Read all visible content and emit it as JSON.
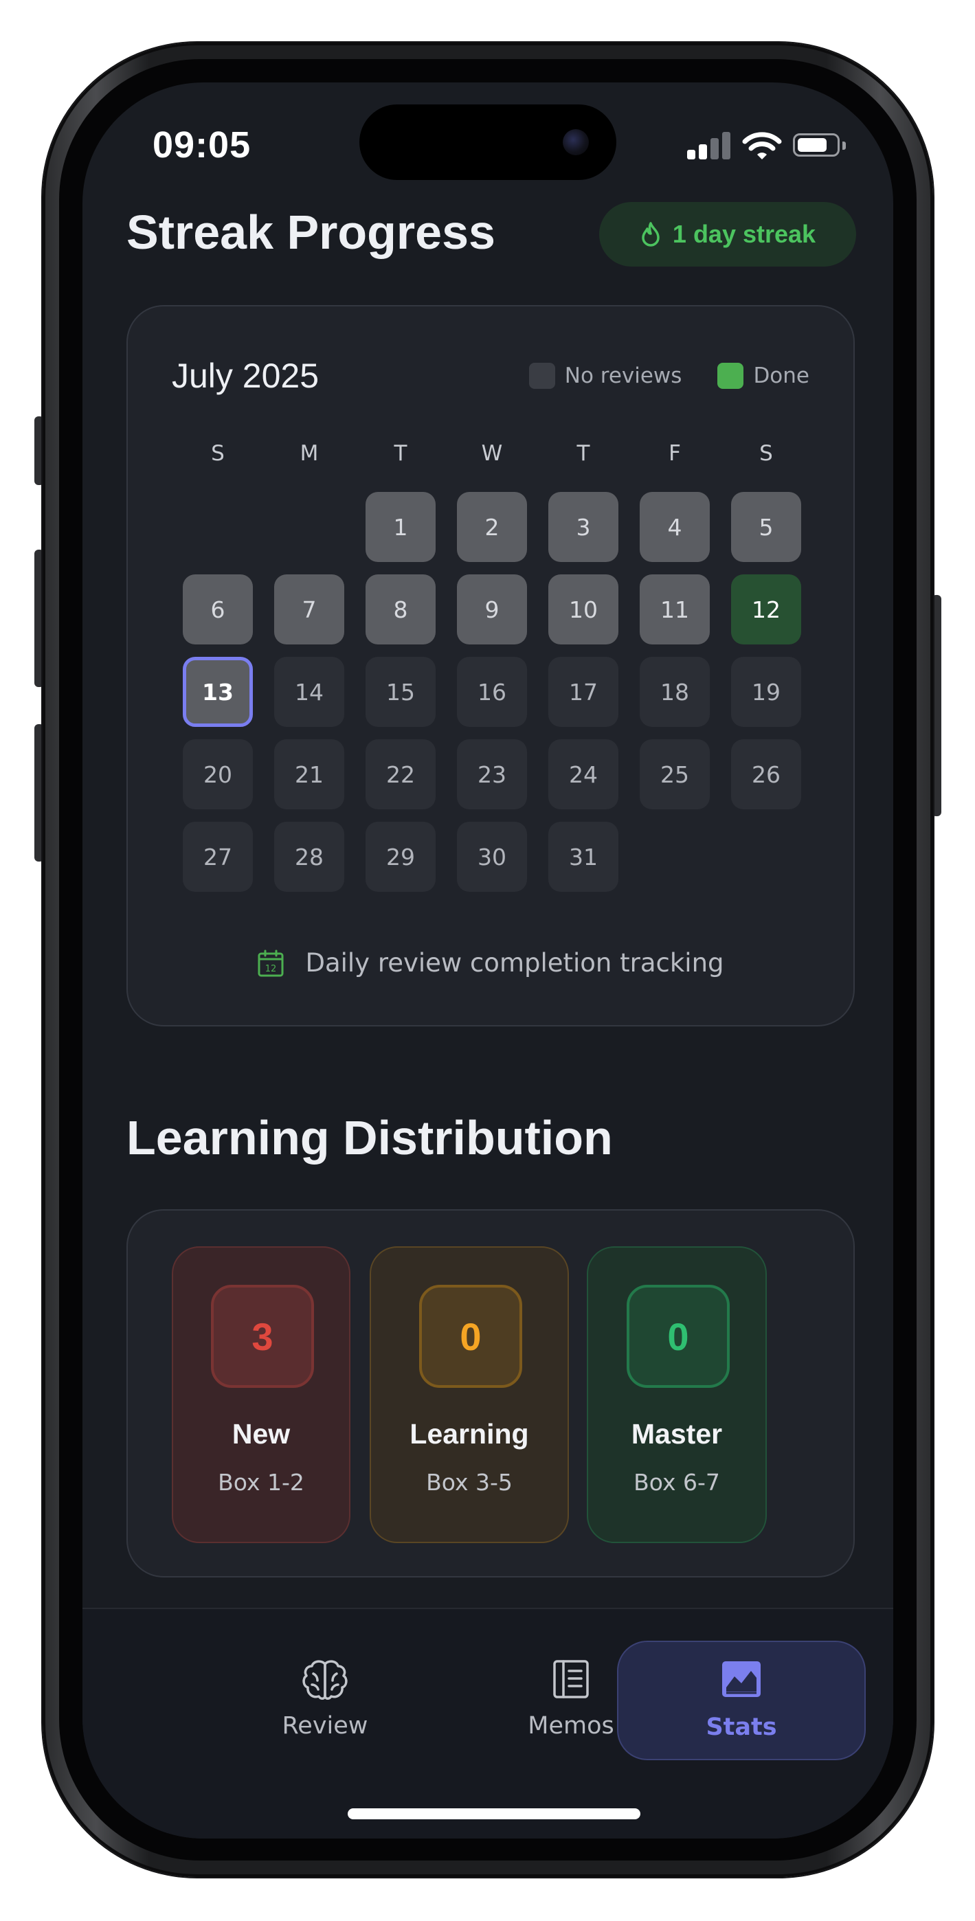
{
  "status_bar": {
    "time": "09:05"
  },
  "streak": {
    "title": "Streak Progress",
    "badge_label": "1 day streak",
    "badge_icon": "flame-icon",
    "accent_color": "#4cc45f"
  },
  "calendar": {
    "month_label": "July 2025",
    "legend": [
      {
        "label": "No reviews",
        "color": "#3a3d44"
      },
      {
        "label": "Done",
        "color": "#4caf50"
      }
    ],
    "weekdays": [
      "S",
      "M",
      "T",
      "W",
      "T",
      "F",
      "S"
    ],
    "first_weekday_index": 2,
    "days": [
      {
        "day": "1",
        "state": "reviewed"
      },
      {
        "day": "2",
        "state": "reviewed"
      },
      {
        "day": "3",
        "state": "reviewed"
      },
      {
        "day": "4",
        "state": "reviewed"
      },
      {
        "day": "5",
        "state": "reviewed"
      },
      {
        "day": "6",
        "state": "reviewed"
      },
      {
        "day": "7",
        "state": "reviewed"
      },
      {
        "day": "8",
        "state": "reviewed"
      },
      {
        "day": "9",
        "state": "reviewed"
      },
      {
        "day": "10",
        "state": "reviewed"
      },
      {
        "day": "11",
        "state": "reviewed"
      },
      {
        "day": "12",
        "state": "done"
      },
      {
        "day": "13",
        "state": "today"
      },
      {
        "day": "14",
        "state": "future"
      },
      {
        "day": "15",
        "state": "future"
      },
      {
        "day": "16",
        "state": "future"
      },
      {
        "day": "17",
        "state": "future"
      },
      {
        "day": "18",
        "state": "future"
      },
      {
        "day": "19",
        "state": "future"
      },
      {
        "day": "20",
        "state": "future"
      },
      {
        "day": "21",
        "state": "future"
      },
      {
        "day": "22",
        "state": "future"
      },
      {
        "day": "23",
        "state": "future"
      },
      {
        "day": "24",
        "state": "future"
      },
      {
        "day": "25",
        "state": "future"
      },
      {
        "day": "26",
        "state": "future"
      },
      {
        "day": "27",
        "state": "future"
      },
      {
        "day": "28",
        "state": "future"
      },
      {
        "day": "29",
        "state": "future"
      },
      {
        "day": "30",
        "state": "future"
      },
      {
        "day": "31",
        "state": "future"
      }
    ],
    "today_outline_color": "#7a7ef0",
    "footer_text": "Daily review completion tracking",
    "footer_icon": "calendar-icon"
  },
  "distribution": {
    "title": "Learning Distribution",
    "boxes": [
      {
        "count": "3",
        "name": "New",
        "range": "Box 1-2",
        "color": "#e0483e"
      },
      {
        "count": "0",
        "name": "Learning",
        "range": "Box 3-5",
        "color": "#f5a524"
      },
      {
        "count": "0",
        "name": "Master",
        "range": "Box 6-7",
        "color": "#2fbf71"
      }
    ]
  },
  "tabbar": {
    "tabs": [
      {
        "label": "Review",
        "icon": "brain-icon",
        "active": false
      },
      {
        "label": "Memos",
        "icon": "notebook-icon",
        "active": false
      },
      {
        "label": "Stats",
        "icon": "chart-icon",
        "active": true
      }
    ],
    "active_color": "#7b7fee"
  }
}
